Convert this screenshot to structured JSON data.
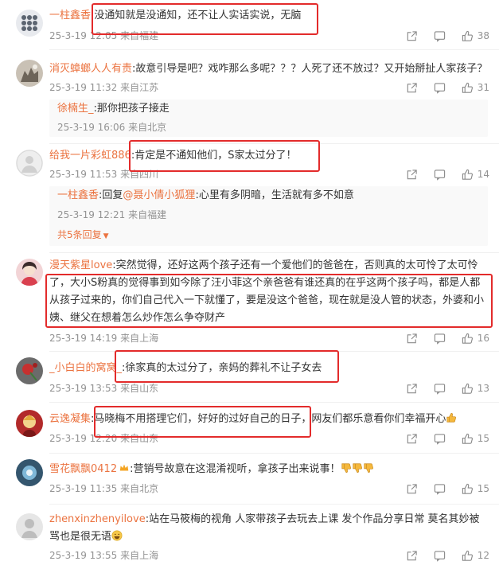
{
  "comments": [
    {
      "user": "一柱鑫香",
      "text": "没通知就是没通知，还不让人实话实说，无脑",
      "date": "25-3-19 12:05",
      "location": "来自福建",
      "likes": "38"
    },
    {
      "user": "消灭蟑螂人人有责",
      "text": "故意引导是吧？戏咋那么多呢？？？人死了还不放过？又开始掰扯人家孩子？",
      "date": "25-3-19 11:32",
      "location": "来自江苏",
      "likes": "31",
      "reply": {
        "user": "徐楠生_",
        "text": "那你把孩子接走",
        "date": "25-3-19 16:06",
        "location": "来自北京"
      }
    },
    {
      "user": "给我一片彩虹886",
      "text": "肯定是不通知他们，S家太过分了！",
      "date": "25-3-19 11:53",
      "location": "来自四川",
      "likes": "14",
      "reply": {
        "user": "一柱鑫香",
        "prefix": "回复",
        "mention": "@聂小倩小狐狸",
        "text": "心里有多阴暗，生活就有多不如意",
        "date": "25-3-19 12:21",
        "location": "来自福建"
      },
      "more": "共5条回复"
    },
    {
      "user": "漫天紫星love",
      "text": "突然觉得，还好这两个孩子还有一个爱他们的爸爸在，否则真的太可怜了太可怜了，大小S粉真的觉得事到如今除了汪小菲这个亲爸爸有谁还真的在乎这两个孩子吗，都是人都从孩子过来的，你们自己代入一下就懂了，要是没这个爸爸，现在就是没人管的状态，外婆和小姨、继父在想着怎么炒作怎么争夺财产",
      "date": "25-3-19 14:19",
      "location": "来自上海",
      "likes": "16"
    },
    {
      "user": "_小白白的窝窝_",
      "text": "徐家真的太过分了，亲妈的葬礼不让子女去",
      "date": "25-3-19 13:53",
      "location": "来自山东",
      "likes": "13"
    },
    {
      "user": "云逸凝集",
      "text": "马晓梅不用搭理它们，好好的过好自己的日子，网友们都乐意看你们幸福开心",
      "date": "25-3-19 12:20",
      "location": "来自山东",
      "likes": "15"
    },
    {
      "user": "雪花飘飘0412",
      "text": "营销号故意在这混淆视听，拿孩子出来说事！",
      "date": "25-3-19 11:35",
      "location": "来自北京",
      "likes": "15"
    },
    {
      "user": "zhenxinzhenyilove",
      "text": "站在马筱梅的视角 人家带孩子去玩去上课 发个作品分享日常 莫名其妙被骂也是很无语",
      "date": "25-3-19 13:55",
      "location": "来自上海",
      "likes": "12"
    }
  ],
  "colors": {
    "username": "#eb7340",
    "meta": "#939393",
    "highlight": "#e32b2b"
  },
  "icons": [
    "share-icon",
    "comment-icon",
    "like-icon",
    "thumbs-down-emoji",
    "thumbs-up-emoji",
    "laugh-emoji",
    "crown-badge"
  ]
}
